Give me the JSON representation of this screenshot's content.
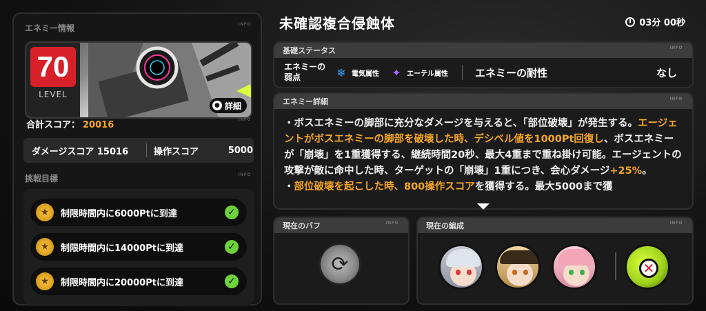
{
  "enemy_info": {
    "section_label": "エネミー情報",
    "level_number": "70",
    "level_label": "LEVEL",
    "detail_button": "詳細",
    "total_score_label": "合計スコア：",
    "total_score_value": "20016",
    "damage_score_label": "ダメージスコア",
    "damage_score_value": "15016",
    "operation_score_label": "操作スコア",
    "operation_score_value": "5000"
  },
  "goals": {
    "section_label": "挑戦目標",
    "items": [
      {
        "label": "制限時間内に6000Ptに到達",
        "done": true
      },
      {
        "label": "制限時間内に14000Ptに到達",
        "done": true
      },
      {
        "label": "制限時間内に20000Ptに到達",
        "done": true
      }
    ]
  },
  "header": {
    "enemy_name": "未確認複合侵蝕体",
    "timer": "03分 00秒"
  },
  "basic_status": {
    "section_label": "基礎ステータス",
    "weakness_label": "エネミーの弱点",
    "weakness_line1": "エネミーの",
    "weakness_line2": "弱点",
    "weak_attrs": [
      {
        "name": "電気属性",
        "icon": "electric-icon",
        "color": "#3aa0ff"
      },
      {
        "name": "エーテル属性",
        "icon": "ether-icon",
        "color": "#b062ff"
      }
    ],
    "resistance_label": "エネミーの耐性",
    "resistance_value": "なし"
  },
  "enemy_detail": {
    "section_label": "エネミー詳細",
    "text_segments": [
      {
        "t": "・ボスエネミーの脚部に充分なダメージを与えると、「部位破壊」が発生する。",
        "hl": false
      },
      {
        "t": "エージェントがボスエネミーの脚部を破壊した時、デシベル値を1000Pt回復し",
        "hl": true
      },
      {
        "t": "、ボスエネミーが「崩壊」を1重獲得する、継続時間20秒、最大4重まで重ね掛け可能。エージェントの攻撃が敵に命中した時、ターゲットの「崩壊」1重につき、会心ダメージ",
        "hl": false
      },
      {
        "t": "+25%",
        "hl": true
      },
      {
        "t": "。",
        "hl": false
      },
      {
        "t": "・",
        "hl": false
      },
      {
        "t": "部位破壊を起こした時、800操作スコア",
        "hl": true
      },
      {
        "t": "を獲得する。最大5000まで獲",
        "hl": false
      }
    ]
  },
  "current_buff": {
    "section_label": "現在のバフ"
  },
  "current_team": {
    "section_label": "現在の編成"
  },
  "info_tag": "INFO"
}
